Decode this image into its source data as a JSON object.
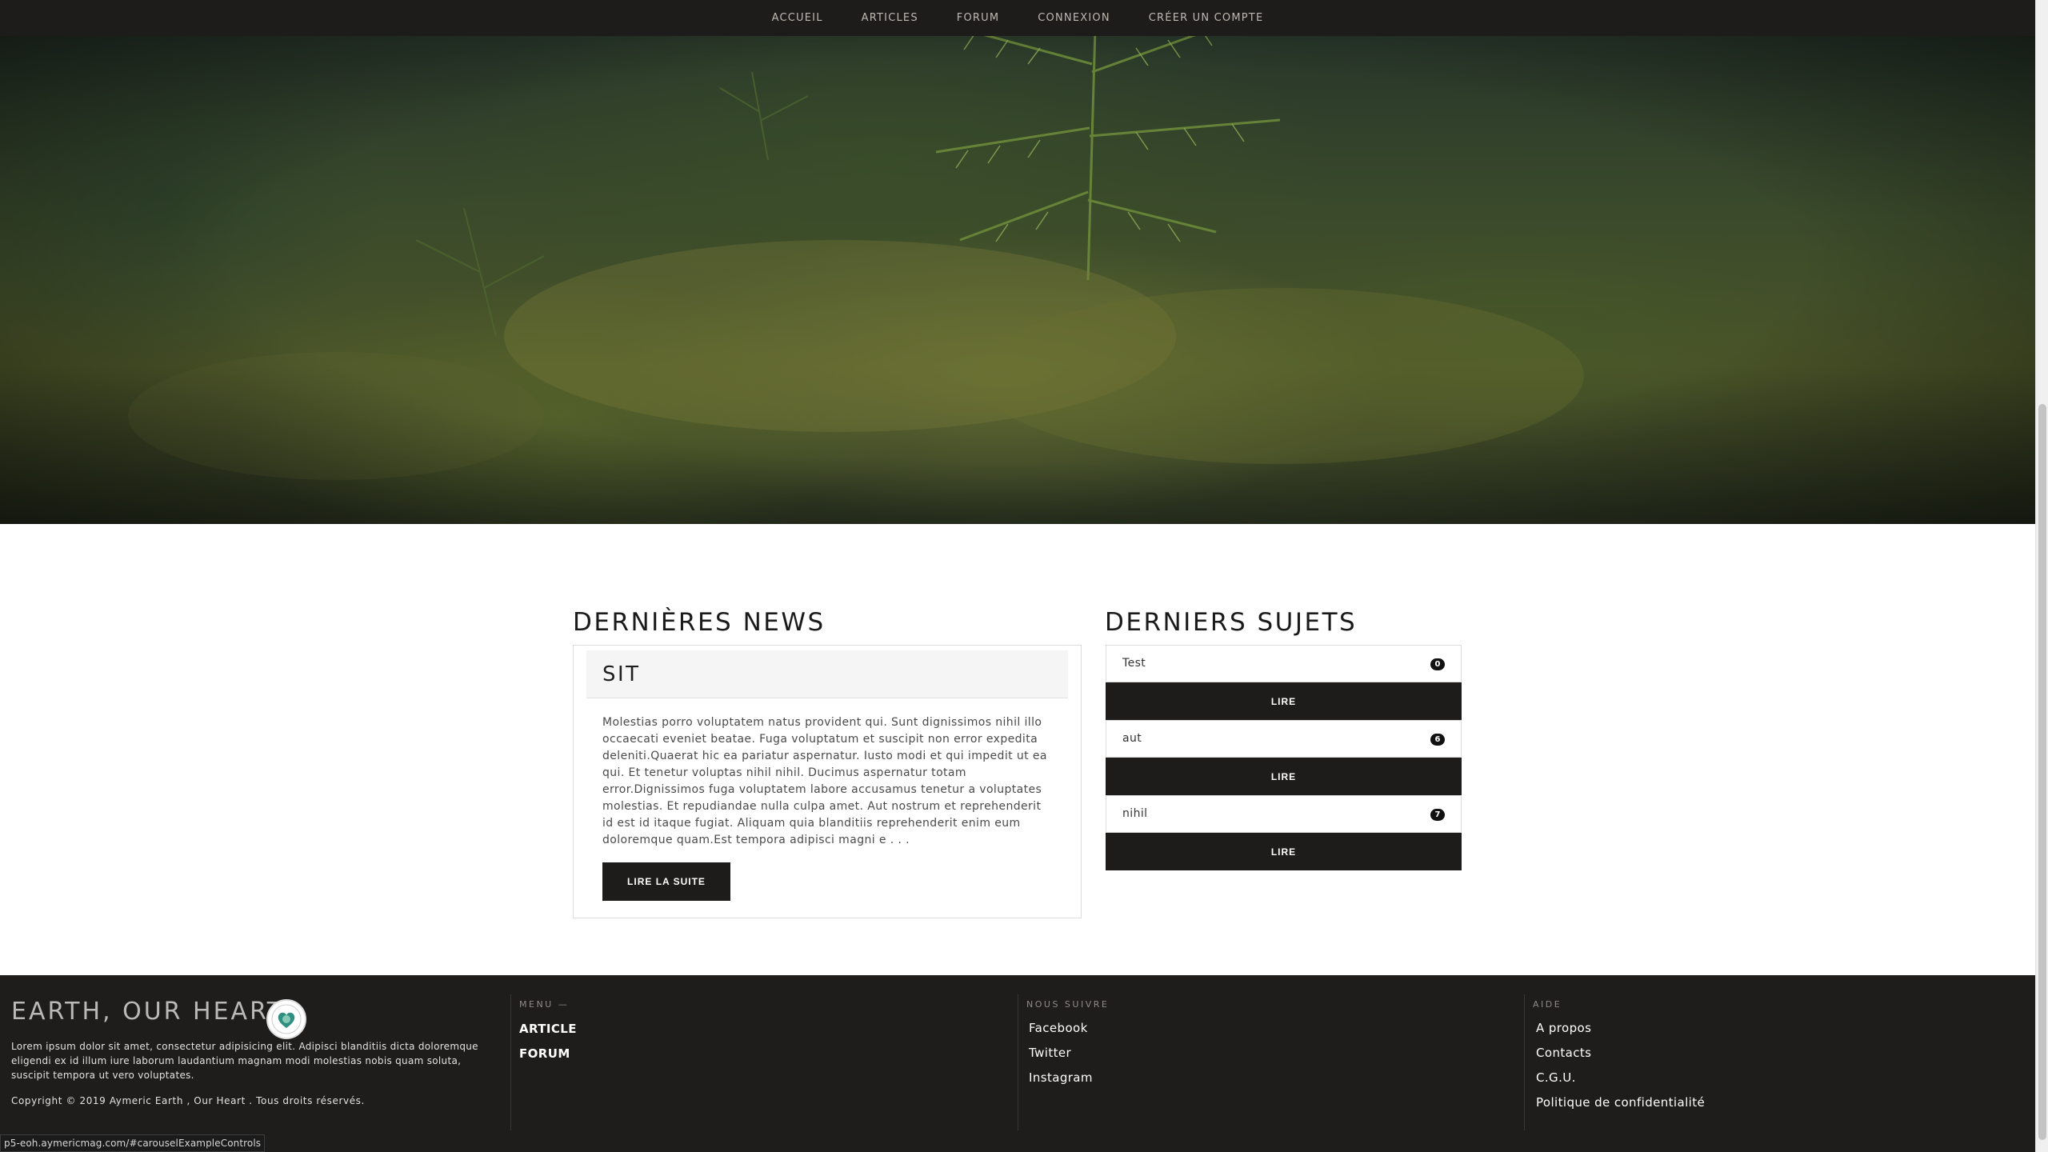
{
  "nav": {
    "items": [
      "ACCUEIL",
      "ARTICLES",
      "FORUM",
      "CONNEXION",
      "CRÉER UN COMPTE"
    ]
  },
  "news": {
    "section_title": "DERNIÈRES NEWS",
    "article_title": "SIT",
    "article_body": "Molestias porro voluptatem natus provident qui. Sunt dignissimos nihil illo occaecati eveniet beatae. Fuga voluptatum et suscipit non error expedita deleniti.Quaerat hic ea pariatur aspernatur. Iusto modi et qui impedit ut ea qui. Et tenetur voluptas nihil nihil. Ducimus aspernatur totam error.Dignissimos fuga voluptatem labore accusamus tenetur a voluptates molestias. Et repudiandae nulla culpa amet. Aut nostrum et reprehenderit id est id itaque fugiat. Aliquam quia blanditiis reprehenderit enim eum doloremque quam.Est tempora adipisci magni e . . .",
    "read_more_label": "LIRE LA SUITE"
  },
  "topics": {
    "section_title": "DERNIERS SUJETS",
    "items": [
      {
        "label": "Test",
        "count": "0",
        "button": "LIRE"
      },
      {
        "label": "aut",
        "count": "6",
        "button": "LIRE"
      },
      {
        "label": "nihil",
        "count": "7",
        "button": "LIRE"
      }
    ]
  },
  "footer": {
    "brand": "EARTH, OUR HEART",
    "description": "Lorem ipsum dolor sit amet, consectetur adipisicing elit. Adipisci blanditiis dicta doloremque eligendi ex id illum iure laborum laudantium magnam modi molestias nobis quam soluta, suscipit tempora ut vero voluptates.",
    "copyright": "Copyright © 2019 Aymeric Earth , Our Heart . Tous droits réservés.",
    "menu": {
      "heading": "MENU —",
      "links": [
        "ARTICLE",
        "FORUM"
      ]
    },
    "follow": {
      "heading": "NOUS SUIVRE",
      "links": [
        "Facebook",
        "Twitter",
        "Instagram"
      ]
    },
    "help": {
      "heading": "AIDE",
      "links": [
        "A propos",
        "Contacts",
        "C.G.U.",
        "Politique de confidentialité"
      ]
    }
  },
  "status_url": "p5-eoh.aymericmag.com/#carouselExampleControls",
  "colors": {
    "nav_bg": "#1e1c1a",
    "footer_bg": "#1f1d1b",
    "button_bg": "#1e1c1a",
    "badge_bg": "#111111"
  }
}
